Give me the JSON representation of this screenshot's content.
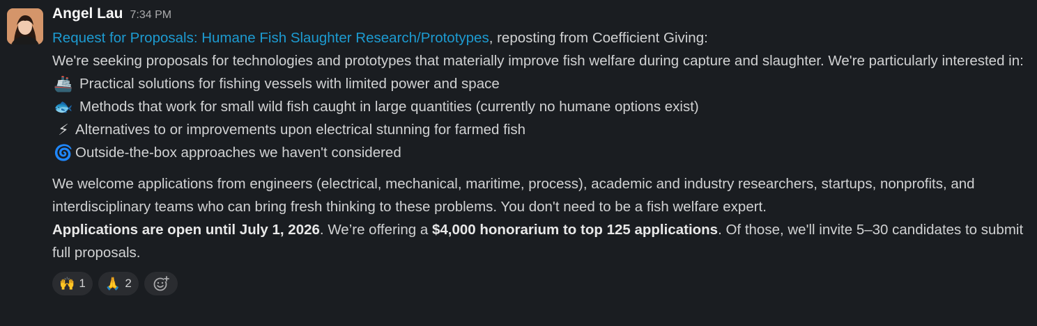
{
  "message": {
    "sender": "Angel Lau",
    "timestamp": "7:34 PM",
    "link_text": "Request for Proposals: Humane Fish Slaughter Research/Prototypes",
    "link_suffix": ", reposting from Coefficient Giving:",
    "intro": "We're seeking proposals for technologies and prototypes that materially improve fish welfare during capture and slaughter. We're particularly interested in:",
    "list_items": [
      {
        "emoji": "🚢",
        "icon": "ship-icon",
        "text": "Practical solutions for fishing vessels with limited power and space"
      },
      {
        "emoji": "🐟",
        "icon": "fish-icon",
        "text": "Methods that work for small wild fish caught in large quantities (currently no humane options exist)"
      },
      {
        "emoji": "⚡",
        "icon": "lightning-icon",
        "text": "Alternatives to or improvements upon electrical stunning for farmed fish"
      },
      {
        "emoji": "🌀",
        "icon": "cyclone-icon",
        "text": "Outside-the-box approaches we haven't considered"
      }
    ],
    "para2": "We welcome applications from engineers (electrical, mechanical, maritime, process), academic and industry researchers, startups, nonprofits, and interdisciplinary teams who can bring fresh thinking to these problems. You don't need to be a fish welfare expert.",
    "para3_bold1": "Applications are open until July 1, 2026",
    "para3_text1": ". We’re offering a ",
    "para3_bold2": "$4,000 honorarium to top 125 applications",
    "para3_text2": ". Of those, we'll invite 5–30 candidates to submit full proposals."
  },
  "reactions": [
    {
      "emoji": "🙌",
      "icon": "raised-hands-icon",
      "count": "1"
    },
    {
      "emoji": "🙏",
      "icon": "folded-hands-icon",
      "count": "2"
    }
  ],
  "colors": {
    "background": "#1a1d21",
    "link": "#1d9bd1",
    "text": "#d1d2d3",
    "reaction_bg": "#2a2c30"
  }
}
